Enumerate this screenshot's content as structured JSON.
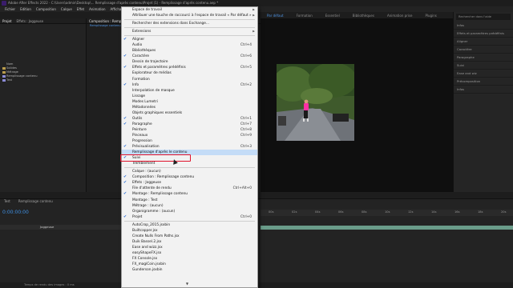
{
  "titlebar": {
    "title": "Adobe After Effects 2022 - C:\\Users\\admin\\Desktop\\... Remplissage d'après contenu\\Projet (1) - Remplissage d'après contenu.aep *"
  },
  "menubar": {
    "items": [
      "Fichier",
      "Edition",
      "Composition",
      "Calque",
      "Effet",
      "Animation",
      "Affichage",
      "Fenêtre"
    ],
    "active": "Fenêtre"
  },
  "workspace": {
    "items": [
      "Par défaut",
      "Formation",
      "Essentiel",
      "Bibliothèques",
      "Animation prise",
      "Plugins"
    ]
  },
  "project_panel": {
    "tabs": [
      "Projet",
      "Effets : Joggeuse"
    ],
    "items": [
      "Nom",
      "Solides",
      "Métrage",
      "Remplissage contenu",
      "Test"
    ]
  },
  "comp_panel": {
    "tab": "Composition : Remplissage contenu",
    "breadcrumb": "Remplissage contenu"
  },
  "right_panel": {
    "search_placeholder": "Rechercher dans l'aide",
    "items": [
      "Infos",
      "Effets et paramètres prédéfinis",
      "Aligner",
      "Caractère",
      "Paragraphe",
      "Suivi",
      "Ease and wiz",
      "Précomposition",
      "Infos"
    ]
  },
  "timeline": {
    "tabs": [
      "Test",
      "Remplissage contenu"
    ],
    "timecode": "0:00:00:00",
    "layer": "Joggeuse",
    "ruler_marks": [
      "00s",
      "02s",
      "04s",
      "06s",
      "08s",
      "10s",
      "12s",
      "14s",
      "16s",
      "18s",
      "20s"
    ]
  },
  "statusbar": {
    "text": "Temps de rendu des images : 0 ms"
  },
  "viewer": {
    "zoom": "50 %"
  },
  "dropdown": {
    "items": [
      {
        "label": "Espace de travail",
        "arrow": true
      },
      {
        "label": "Attribuer une touche de raccourci à l'espace de travail « Par défaut »",
        "arrow": true
      },
      {
        "sep": true
      },
      {
        "label": "Rechercher des extensions dans Exchange..."
      },
      {
        "sep": true
      },
      {
        "label": "Extensions",
        "arrow": true
      },
      {
        "sep": true
      },
      {
        "label": "Aligner",
        "check": true
      },
      {
        "label": "Audio",
        "shortcut": "Ctrl+4"
      },
      {
        "label": "Bibliothèques"
      },
      {
        "label": "Caractère",
        "check": true,
        "shortcut": "Ctrl+6"
      },
      {
        "label": "Dessin de trajectoire"
      },
      {
        "label": "Effets et paramètres prédéfinis",
        "check": true,
        "shortcut": "Ctrl+5"
      },
      {
        "label": "Explorateur de médias"
      },
      {
        "label": "Formation"
      },
      {
        "label": "Info",
        "check": true,
        "shortcut": "Ctrl+2"
      },
      {
        "label": "Interpolation de masque"
      },
      {
        "label": "Lissage"
      },
      {
        "label": "Modes Lumetri"
      },
      {
        "label": "Métadonnées"
      },
      {
        "label": "Objets graphiques essentiels"
      },
      {
        "label": "Outils",
        "check": true,
        "shortcut": "Ctrl+1"
      },
      {
        "label": "Paragraphe",
        "check": true,
        "shortcut": "Ctrl+7"
      },
      {
        "label": "Peinture",
        "shortcut": "Ctrl+8"
      },
      {
        "label": "Pinceaux",
        "shortcut": "Ctrl+9"
      },
      {
        "label": "Progression"
      },
      {
        "label": "Prévisualisation",
        "check": true,
        "shortcut": "Ctrl+3"
      },
      {
        "label": "Remplissage d'après le contenu",
        "highlight": true
      },
      {
        "label": "Suivi",
        "check": true
      },
      {
        "label": "Tremblement"
      },
      {
        "sep": true
      },
      {
        "label": "Calque : (aucun)"
      },
      {
        "label": "Composition : Remplissage contenu",
        "check": true
      },
      {
        "label": "Effets : Joggeuse",
        "check": true
      },
      {
        "label": "File d'attente de rendu",
        "shortcut": "Ctrl+Alt+0"
      },
      {
        "label": "Montage : Remplissage contenu",
        "check": true
      },
      {
        "label": "Montage : Test"
      },
      {
        "label": "Métrage : (aucun)"
      },
      {
        "label": "Organigramme : (aucun)"
      },
      {
        "label": "Projet",
        "check": true,
        "shortcut": "Ctrl+0"
      },
      {
        "sep": true
      },
      {
        "label": "AutoCrop_2015.jsxbin"
      },
      {
        "label": "Builtcapper.jsx"
      },
      {
        "label": "Create Nulls From Paths.jsx"
      },
      {
        "label": "Duik Bassel.2.jsx"
      },
      {
        "label": "Ease and wizz.jsx"
      },
      {
        "label": "easyShapeFX.jsx"
      },
      {
        "label": "FX Console.jsx"
      },
      {
        "label": "FX_magiCoin.jsxbin"
      },
      {
        "label": "Gunderson.jsxbin"
      }
    ],
    "scroll_arrow": "▼"
  },
  "colors": {
    "accent": "#3d6fc2",
    "highlight_box": "#e0122b",
    "timecode": "#3e8ee0"
  }
}
